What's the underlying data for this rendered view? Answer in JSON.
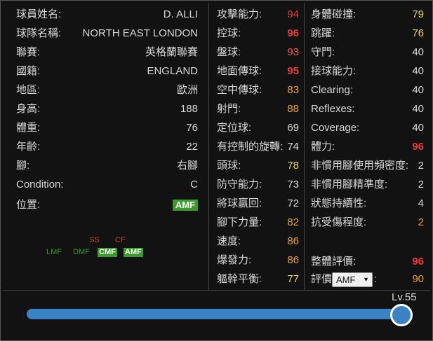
{
  "colors": {
    "green": "#33aa33",
    "yellow": "#e6d85a",
    "orange": "#e8a33a",
    "red": "#e83a3a",
    "light_red": "#ff5a4a",
    "badge": "#3a9a2a",
    "slider": "#3b82c4"
  },
  "player": [
    {
      "label": "球員姓名:",
      "value": "D. ALLI"
    },
    {
      "label": "球隊名稱:",
      "value": "NORTH EAST LONDON"
    },
    {
      "label": "聯賽:",
      "value": "英格蘭聯賽"
    },
    {
      "label": "國籍:",
      "value": "ENGLAND"
    },
    {
      "label": "地區:",
      "value": "歐洲"
    },
    {
      "label": "身高:",
      "value": "188"
    },
    {
      "label": "體重:",
      "value": "76"
    },
    {
      "label": "年齡:",
      "value": "22"
    },
    {
      "label": "腳:",
      "value": "右腳"
    },
    {
      "label": "Condition:",
      "value": "C"
    }
  ],
  "position": {
    "label": "位置:",
    "value": "AMF"
  },
  "position_map": [
    {
      "name": "SS",
      "color": "#c84040",
      "highlight": false
    },
    {
      "name": "CF",
      "color": "#c84040",
      "highlight": false
    },
    {
      "name": "LMF",
      "color": "#3a9a2a",
      "highlight": false
    },
    {
      "name": "DMF",
      "color": "#3a9a2a",
      "highlight": false
    },
    {
      "name": "CMF",
      "color": "#ffffff",
      "highlight": true
    },
    {
      "name": "AMF",
      "color": "#ffffff",
      "highlight": true
    }
  ],
  "abilities": [
    {
      "label": "攻擊能力:",
      "value": "94",
      "color": "#e83a3a",
      "bold": false
    },
    {
      "label": "控球:",
      "value": "96",
      "color": "#e83a3a",
      "bold": true
    },
    {
      "label": "盤球:",
      "value": "93",
      "color": "#ff5a4a",
      "bold": false
    },
    {
      "label": "地面傳球:",
      "value": "95",
      "color": "#e83a3a",
      "bold": true
    },
    {
      "label": "空中傳球:",
      "value": "83",
      "color": "#e8a33a",
      "bold": false
    },
    {
      "label": "射門:",
      "value": "88",
      "color": "#e8a33a",
      "bold": false
    },
    {
      "label": "定位球:",
      "value": "69",
      "color": "#d8d8d8",
      "bold": false
    },
    {
      "label": "有控制的旋轉:",
      "value": "74",
      "color": "#d8d8d8",
      "bold": false
    },
    {
      "label": "頭球:",
      "value": "78",
      "color": "#e6d85a",
      "bold": false
    },
    {
      "label": "防守能力:",
      "value": "73",
      "color": "#d8d8d8",
      "bold": false
    },
    {
      "label": "將球贏回:",
      "value": "72",
      "color": "#d8d8d8",
      "bold": false
    },
    {
      "label": "腳下力量:",
      "value": "82",
      "color": "#e8a33a",
      "bold": false
    },
    {
      "label": "速度:",
      "value": "86",
      "color": "#e8a33a",
      "bold": false
    },
    {
      "label": "爆發力:",
      "value": "86",
      "color": "#e8a33a",
      "bold": false
    },
    {
      "label": "軀幹平衡:",
      "value": "77",
      "color": "#e6d85a",
      "bold": false
    }
  ],
  "physical": [
    {
      "label": "身體碰撞:",
      "value": "79",
      "color": "#e6d85a",
      "bold": false
    },
    {
      "label": "跳躍:",
      "value": "76",
      "color": "#e6d85a",
      "bold": false
    },
    {
      "label": "守門:",
      "value": "40",
      "color": "#d8d8d8",
      "bold": false
    },
    {
      "label": "接球能力:",
      "value": "40",
      "color": "#d8d8d8",
      "bold": false
    },
    {
      "label": "Clearing:",
      "value": "40",
      "color": "#d8d8d8",
      "bold": false
    },
    {
      "label": "Reflexes:",
      "value": "40",
      "color": "#d8d8d8",
      "bold": false
    },
    {
      "label": "Coverage:",
      "value": "40",
      "color": "#d8d8d8",
      "bold": false
    },
    {
      "label": "體力:",
      "value": "96",
      "color": "#e83a3a",
      "bold": true
    },
    {
      "label": "非慣用腳使用頻密度:",
      "value": "2",
      "color": "#d8d8d8",
      "bold": false
    },
    {
      "label": "非慣用腳精準度:",
      "value": "2",
      "color": "#d8d8d8",
      "bold": false
    },
    {
      "label": "狀態持續性:",
      "value": "4",
      "color": "#d8d8d8",
      "bold": false
    },
    {
      "label": "抗受傷程度:",
      "value": "2",
      "color": "#e8a33a",
      "bold": false
    }
  ],
  "overall": {
    "label": "整體評價:",
    "value": "96",
    "color": "#e83a3a"
  },
  "rating": {
    "label": "評價",
    "select": "AMF",
    "colon": ":",
    "value": "90",
    "color": "#e8a33a"
  },
  "level": {
    "label": "Lv.55",
    "value": 55,
    "fraction": 0.98
  }
}
